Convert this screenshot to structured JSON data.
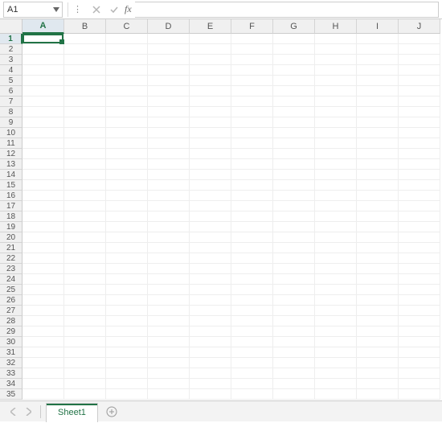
{
  "nameBox": {
    "value": "A1"
  },
  "formula": {
    "value": "",
    "fxLabel": "fx"
  },
  "columns": [
    "A",
    "B",
    "C",
    "D",
    "E",
    "F",
    "G",
    "H",
    "I",
    "J"
  ],
  "rows": [
    "1",
    "2",
    "3",
    "4",
    "5",
    "6",
    "7",
    "8",
    "9",
    "10",
    "11",
    "12",
    "13",
    "14",
    "15",
    "16",
    "17",
    "18",
    "19",
    "20",
    "21",
    "22",
    "23",
    "24",
    "25",
    "26",
    "27",
    "28",
    "29",
    "30",
    "31",
    "32",
    "33",
    "34",
    "35"
  ],
  "activeCell": {
    "col": "A",
    "row": "1"
  },
  "sheetTabs": {
    "active": "Sheet1"
  }
}
